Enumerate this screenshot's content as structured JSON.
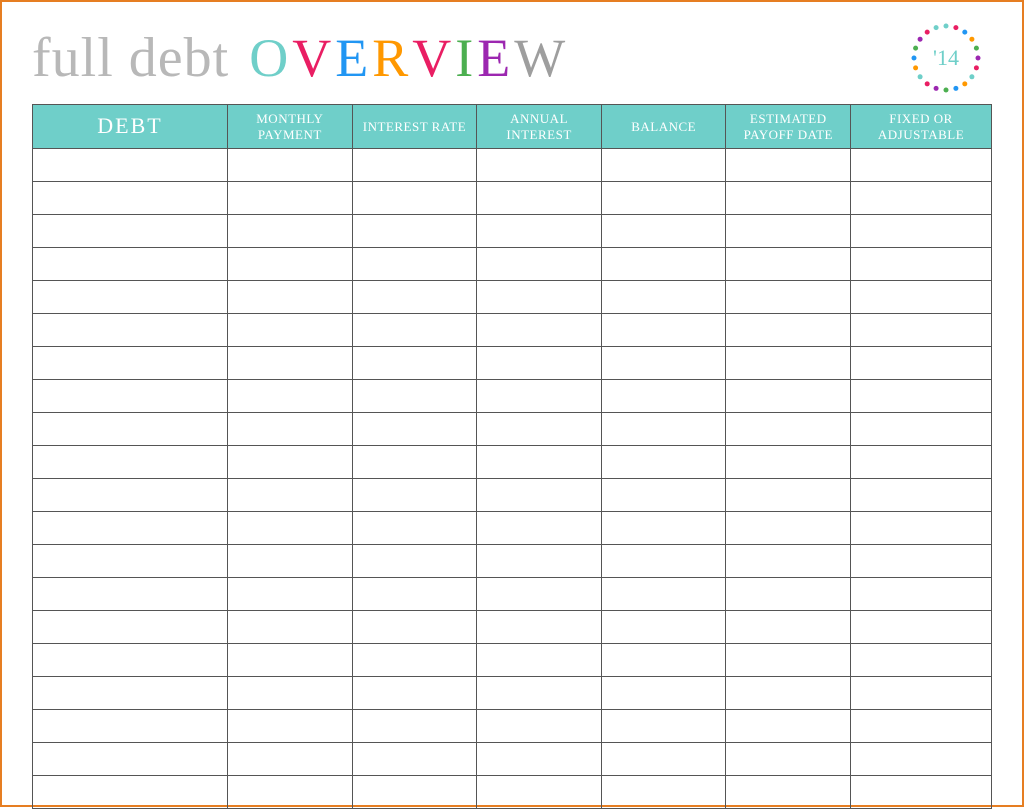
{
  "header": {
    "title_prefix": "full debt",
    "title_main_letters": [
      {
        "char": "O",
        "color": "#6fcfc9"
      },
      {
        "char": "V",
        "color": "#e91e63"
      },
      {
        "char": "E",
        "color": "#2196f3"
      },
      {
        "char": "R",
        "color": "#ff9800"
      },
      {
        "char": "V",
        "color": "#e91e63"
      },
      {
        "char": "I",
        "color": "#4caf50"
      },
      {
        "char": "E",
        "color": "#9c27b0"
      },
      {
        "char": "W",
        "color": "#9e9e9e"
      }
    ],
    "badge_text": "'14",
    "badge_dot_colors": [
      "#6fcfc9",
      "#e91e63",
      "#2196f3",
      "#ff9800",
      "#4caf50",
      "#9c27b0",
      "#e91e63",
      "#6fcfc9",
      "#ff9800",
      "#2196f3",
      "#4caf50",
      "#9c27b0",
      "#e91e63",
      "#6fcfc9",
      "#ff9800",
      "#2196f3",
      "#4caf50",
      "#9c27b0",
      "#e91e63",
      "#6fcfc9"
    ]
  },
  "table": {
    "columns": [
      {
        "label": "DEBT",
        "class": "col-debt"
      },
      {
        "label": "MONTHLY PAYMENT",
        "class": "col-std"
      },
      {
        "label": "INTEREST RATE",
        "class": "col-std"
      },
      {
        "label": "ANNUAL INTEREST",
        "class": "col-std"
      },
      {
        "label": "BALANCE",
        "class": "col-std"
      },
      {
        "label": "ESTIMATED PAYOFF DATE",
        "class": "col-std"
      },
      {
        "label": "FIXED OR ADJUSTABLE",
        "class": "col-fixed"
      }
    ],
    "row_count": 20
  },
  "colors": {
    "border": "#e67e22",
    "header_bg": "#6fcfc9",
    "title_grey": "#b8b8b8"
  }
}
